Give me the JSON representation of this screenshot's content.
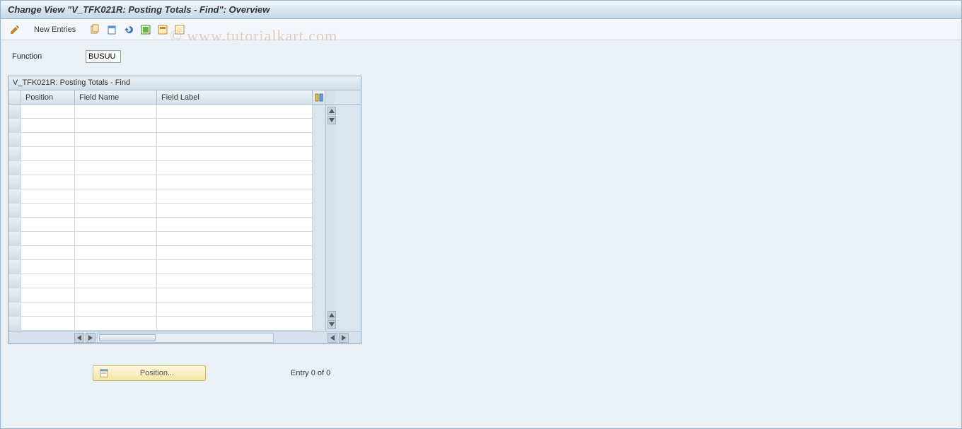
{
  "header": {
    "title": "Change View \"V_TFK021R: Posting Totals - Find\": Overview"
  },
  "toolbar": {
    "new_entries_label": "New Entries",
    "icons": {
      "pencil": "edit-icon",
      "copy": "copy-icon",
      "cut": "cut-icon",
      "undo": "undo-icon",
      "select_all": "select-all-icon",
      "deselect": "deselect-icon"
    }
  },
  "watermark": "© www.tutorialkart.com",
  "function_field": {
    "label": "Function",
    "value": "BUSUU"
  },
  "panel": {
    "title": "V_TFK021R: Posting Totals - Find",
    "columns": {
      "position": "Position",
      "field_name": "Field Name",
      "field_label": "Field Label"
    },
    "rows": []
  },
  "footer": {
    "position_button": "Position...",
    "entry_text": "Entry 0 of 0"
  }
}
